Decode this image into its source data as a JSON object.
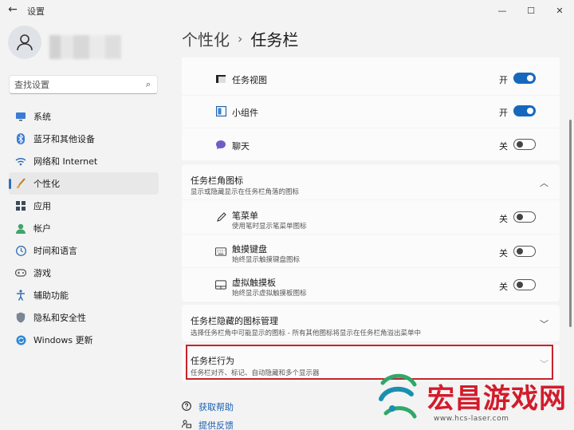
{
  "window": {
    "title": "设置",
    "controls": {
      "minimize": "—",
      "maximize": "☐",
      "close": "✕"
    }
  },
  "search": {
    "placeholder": "查找设置"
  },
  "sidebar": {
    "items": [
      {
        "label": "系统",
        "icon": "monitor-icon",
        "active": false
      },
      {
        "label": "蓝牙和其他设备",
        "icon": "bluetooth-icon",
        "active": false
      },
      {
        "label": "网络和 Internet",
        "icon": "network-icon",
        "active": false
      },
      {
        "label": "个性化",
        "icon": "brush-icon",
        "active": true
      },
      {
        "label": "应用",
        "icon": "apps-icon",
        "active": false
      },
      {
        "label": "帐户",
        "icon": "account-icon",
        "active": false
      },
      {
        "label": "时间和语言",
        "icon": "time-language-icon",
        "active": false
      },
      {
        "label": "游戏",
        "icon": "gamepad-icon",
        "active": false
      },
      {
        "label": "辅助功能",
        "icon": "accessibility-icon",
        "active": false
      },
      {
        "label": "隐私和安全性",
        "icon": "shield-icon",
        "active": false
      },
      {
        "label": "Windows 更新",
        "icon": "update-icon",
        "active": false
      }
    ]
  },
  "breadcrumb": {
    "parent": "个性化",
    "separator": "›",
    "current": "任务栏"
  },
  "taskbar_items": [
    {
      "label": "任务视图",
      "state": "开",
      "on": true,
      "icon": "task-view-icon"
    },
    {
      "label": "小组件",
      "state": "开",
      "on": true,
      "icon": "widgets-icon"
    },
    {
      "label": "聊天",
      "state": "关",
      "on": false,
      "icon": "chat-icon"
    }
  ],
  "corner_icons": {
    "title": "任务栏角图标",
    "desc": "显示或隐藏显示在任务栏角落的图标",
    "items": [
      {
        "label": "笔菜单",
        "desc": "使用笔时显示笔菜单图标",
        "state": "关",
        "on": false,
        "icon": "pen-icon"
      },
      {
        "label": "触摸键盘",
        "desc": "始终显示触摸键盘图标",
        "state": "关",
        "on": false,
        "icon": "keyboard-icon"
      },
      {
        "label": "虚拟触摸板",
        "desc": "始终显示虚拟触摸板图标",
        "state": "关",
        "on": false,
        "icon": "touchpad-icon"
      }
    ]
  },
  "hidden_icons": {
    "title": "任务栏隐藏的图标管理",
    "desc": "选择任务栏角中可能显示的图标 - 所有其他图标将显示在任务栏角溢出菜单中"
  },
  "behaviors": {
    "title": "任务栏行为",
    "desc": "任务栏对齐、标记、自动隐藏和多个显示器"
  },
  "links": {
    "help": "获取帮助",
    "feedback": "提供反馈"
  },
  "watermark": {
    "text": "宏昌游戏网",
    "url": "www.hcs-laser.com"
  },
  "colors": {
    "accent": "#1768bc",
    "highlight_border": "#c8232c",
    "watermark": "#d31b2b"
  }
}
